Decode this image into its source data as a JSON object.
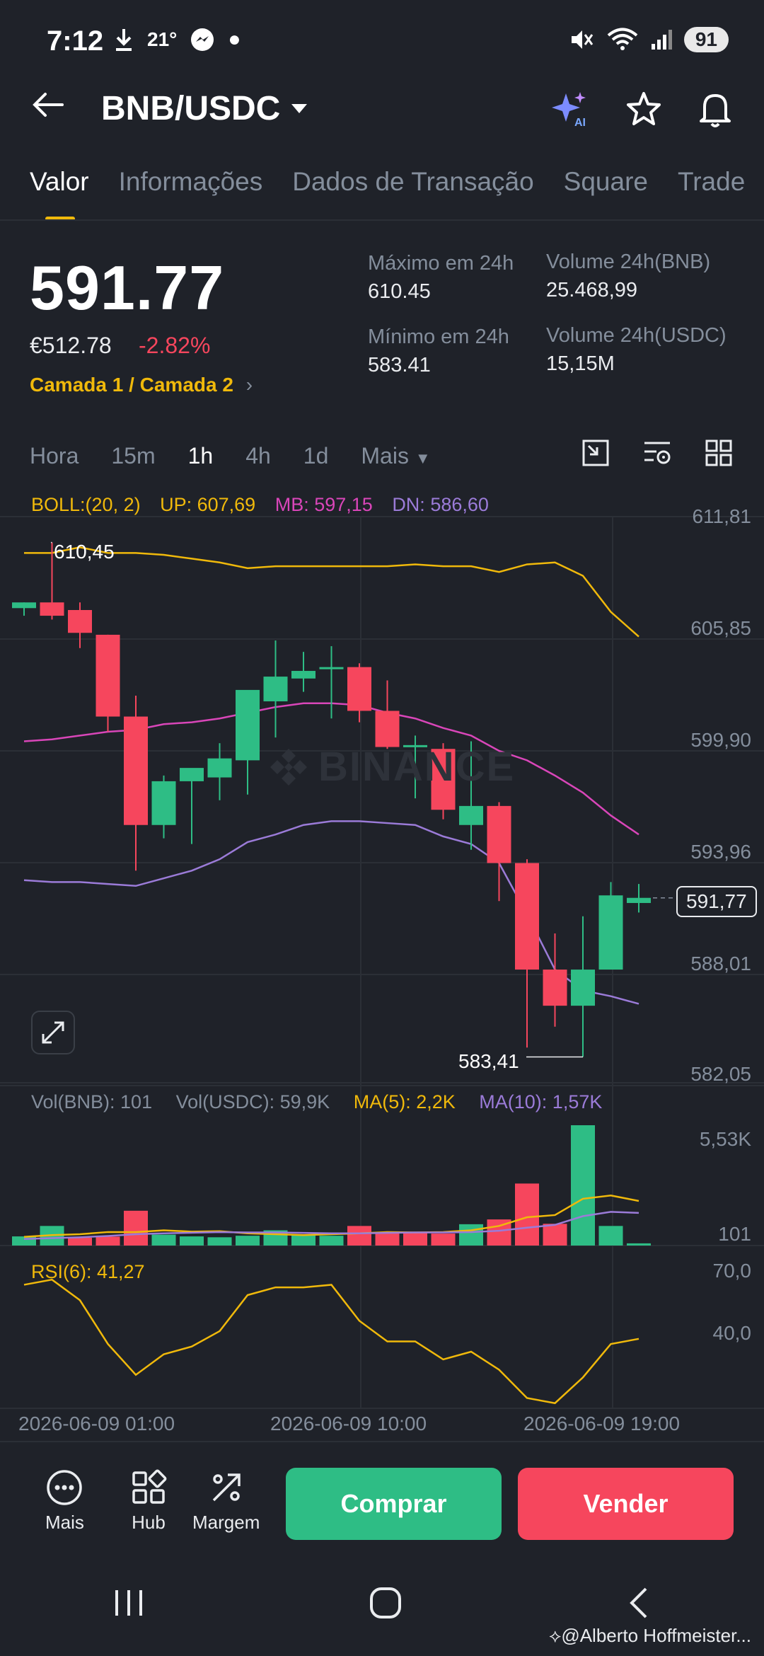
{
  "status": {
    "time": "7:12",
    "temp": "21°",
    "battery": "91"
  },
  "header": {
    "pair": "BNB/USDC"
  },
  "tabs": [
    "Valor",
    "Informações",
    "Dados de Transação",
    "Square",
    "Trade"
  ],
  "price": {
    "last": "591.77",
    "fiat": "€512.78",
    "change": "-2.82%",
    "layer": "Camada 1 / Camada 2"
  },
  "stats": {
    "high_label": "Máximo em 24h",
    "high": "610.45",
    "low_label": "Mínimo em 24h",
    "low": "583.41",
    "vol_bnb_label": "Volume 24h(BNB)",
    "vol_bnb": "25.468,99",
    "vol_usdc_label": "Volume 24h(USDC)",
    "vol_usdc": "15,15M"
  },
  "intervals": [
    "Hora",
    "15m",
    "1h",
    "4h",
    "1d",
    "Mais"
  ],
  "boll": {
    "label": "BOLL:(20, 2)",
    "up": "UP: 607,69",
    "mb": "MB: 597,15",
    "dn": "DN: 586,60"
  },
  "price_axis": [
    "611,81",
    "605,85",
    "599,90",
    "593,96",
    "588,01",
    "582,05"
  ],
  "current_price_tag": "591,77",
  "high_marker": "610,45",
  "low_marker": "583,41",
  "watermark": "BINANCE",
  "vol_legend": {
    "bnb": "Vol(BNB): 101",
    "usdc": "Vol(USDC): 59,9K",
    "ma5": "MA(5): 2,2K",
    "ma10": "MA(10): 1,57K"
  },
  "vol_axis": [
    "5,53K",
    "101"
  ],
  "rsi": {
    "label": "RSI(6): 41,27",
    "axis": [
      "70,0",
      "40,0"
    ]
  },
  "time_axis": [
    "2026-06-09 01:00",
    "2026-06-09 10:00",
    "2026-06-09 19:00"
  ],
  "bottom": {
    "more": "Mais",
    "hub": "Hub",
    "margin": "Margem",
    "buy": "Comprar",
    "sell": "Vender"
  },
  "credit": "@Alberto  Hoffmeister...",
  "colors": {
    "up": "#2ebd85",
    "down": "#f6465d",
    "accent": "#f0b90b",
    "mb": "#d946b9",
    "dn": "#9b7bd8"
  },
  "chart_data": {
    "type": "candlestick",
    "title": "BNB/USDC 1h",
    "ylim": [
      582.05,
      611.81
    ],
    "candles": [
      {
        "o": 607.0,
        "h": 607.3,
        "c": 607.3,
        "l": 606.6
      },
      {
        "o": 607.3,
        "h": 610.45,
        "c": 606.6,
        "l": 606.4
      },
      {
        "o": 606.9,
        "h": 607.3,
        "c": 605.7,
        "l": 604.9
      },
      {
        "o": 605.6,
        "h": 605.6,
        "c": 601.3,
        "l": 600.5
      },
      {
        "o": 601.3,
        "h": 602.4,
        "c": 595.6,
        "l": 593.2
      },
      {
        "o": 595.6,
        "h": 598.2,
        "c": 597.9,
        "l": 594.9
      },
      {
        "o": 597.9,
        "h": 598.5,
        "c": 598.6,
        "l": 594.6
      },
      {
        "o": 598.1,
        "h": 599.9,
        "c": 599.1,
        "l": 596.9
      },
      {
        "o": 599.0,
        "h": 602.4,
        "c": 602.7,
        "l": 597.2
      },
      {
        "o": 602.1,
        "h": 605.3,
        "c": 603.4,
        "l": 600.2
      },
      {
        "o": 603.3,
        "h": 604.7,
        "c": 603.7,
        "l": 602.6
      },
      {
        "o": 603.9,
        "h": 605.0,
        "c": 603.9,
        "l": 601.2
      },
      {
        "o": 603.9,
        "h": 604.1,
        "c": 601.6,
        "l": 601.0
      },
      {
        "o": 601.6,
        "h": 603.2,
        "c": 599.7,
        "l": 599.6
      },
      {
        "o": 599.8,
        "h": 600.3,
        "c": 599.8,
        "l": 597.0
      },
      {
        "o": 599.6,
        "h": 599.9,
        "c": 596.4,
        "l": 595.9
      },
      {
        "o": 595.6,
        "h": 600.0,
        "c": 596.6,
        "l": 594.3
      },
      {
        "o": 596.6,
        "h": 596.8,
        "c": 593.6,
        "l": 591.6
      },
      {
        "o": 593.6,
        "h": 593.8,
        "c": 588.0,
        "l": 583.9
      },
      {
        "o": 588.0,
        "h": 589.9,
        "c": 586.1,
        "l": 585.0
      },
      {
        "o": 586.1,
        "h": 590.8,
        "c": 588.0,
        "l": 583.41
      },
      {
        "o": 588.0,
        "h": 592.6,
        "c": 591.9,
        "l": 589.5
      },
      {
        "o": 591.5,
        "h": 592.5,
        "c": 591.77,
        "l": 591.0
      }
    ],
    "boll_up": [
      609.9,
      609.9,
      610.2,
      609.9,
      609.9,
      609.8,
      609.6,
      609.4,
      609.1,
      609.2,
      609.2,
      609.2,
      609.2,
      609.2,
      609.3,
      609.2,
      609.2,
      608.9,
      609.3,
      609.4,
      608.7,
      606.8,
      605.5
    ],
    "boll_mb": [
      600.0,
      600.1,
      600.3,
      600.5,
      600.6,
      600.9,
      601.0,
      601.2,
      601.5,
      601.8,
      602.0,
      602.0,
      601.9,
      601.5,
      601.2,
      600.7,
      600.3,
      599.5,
      599.0,
      598.2,
      597.3,
      596.1,
      595.1
    ],
    "boll_dn": [
      592.7,
      592.6,
      592.6,
      592.5,
      592.4,
      592.8,
      593.2,
      593.8,
      594.7,
      595.1,
      595.6,
      595.8,
      595.8,
      595.7,
      595.6,
      595.0,
      594.6,
      593.6,
      590.9,
      588.0,
      586.9,
      586.6,
      586.2
    ],
    "volume": [
      420,
      900,
      360,
      410,
      1600,
      500,
      420,
      380,
      450,
      700,
      480,
      450,
      900,
      600,
      600,
      550,
      980,
      1200,
      2850,
      1000,
      5530,
      900,
      101
    ],
    "volume_up": [
      true,
      true,
      false,
      false,
      false,
      true,
      true,
      true,
      true,
      true,
      true,
      true,
      false,
      false,
      false,
      false,
      true,
      false,
      false,
      false,
      true,
      true,
      true
    ],
    "vol_ma5": [
      400,
      480,
      520,
      620,
      620,
      700,
      640,
      660,
      560,
      520,
      480,
      520,
      560,
      620,
      600,
      620,
      700,
      900,
      1300,
      1400,
      2150,
      2300,
      2050
    ],
    "vol_ma10": [
      300,
      340,
      380,
      440,
      520,
      560,
      590,
      620,
      600,
      600,
      580,
      560,
      560,
      580,
      600,
      600,
      620,
      680,
      820,
      950,
      1350,
      1550,
      1500
    ],
    "rsi6": [
      68,
      70,
      62,
      45,
      33,
      41,
      44,
      50,
      64,
      67,
      67,
      68,
      54,
      46,
      46,
      39,
      42,
      35,
      24,
      22,
      32,
      45,
      47
    ]
  }
}
